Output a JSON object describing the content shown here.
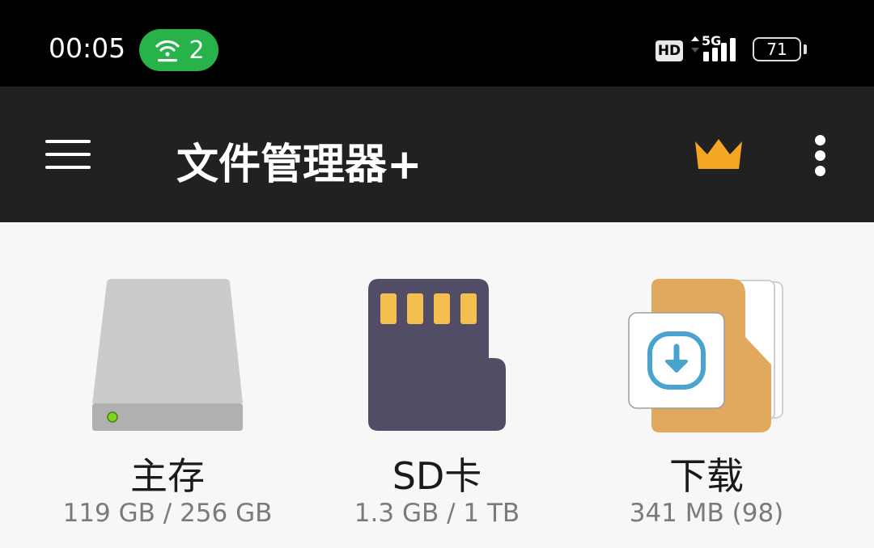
{
  "status_bar": {
    "time": "00:05",
    "hotspot_count": "2",
    "hd_label": "HD",
    "network_label": "5G",
    "battery_level": "71"
  },
  "app_bar": {
    "title": "文件管理器+"
  },
  "storage": [
    {
      "label": "主存",
      "detail": "119 GB / 256 GB",
      "icon": "hard-drive-icon"
    },
    {
      "label": "SD卡",
      "detail": "1.3 GB / 1 TB",
      "icon": "sd-card-icon"
    },
    {
      "label": "下载",
      "detail": "341 MB (98)",
      "icon": "downloads-folder-icon"
    }
  ],
  "colors": {
    "status_bar_bg": "#000000",
    "app_bar_bg": "#212121",
    "hotspot_green": "#27b24a",
    "crown_orange": "#f5a623",
    "page_bg": "#f7f7f7"
  }
}
